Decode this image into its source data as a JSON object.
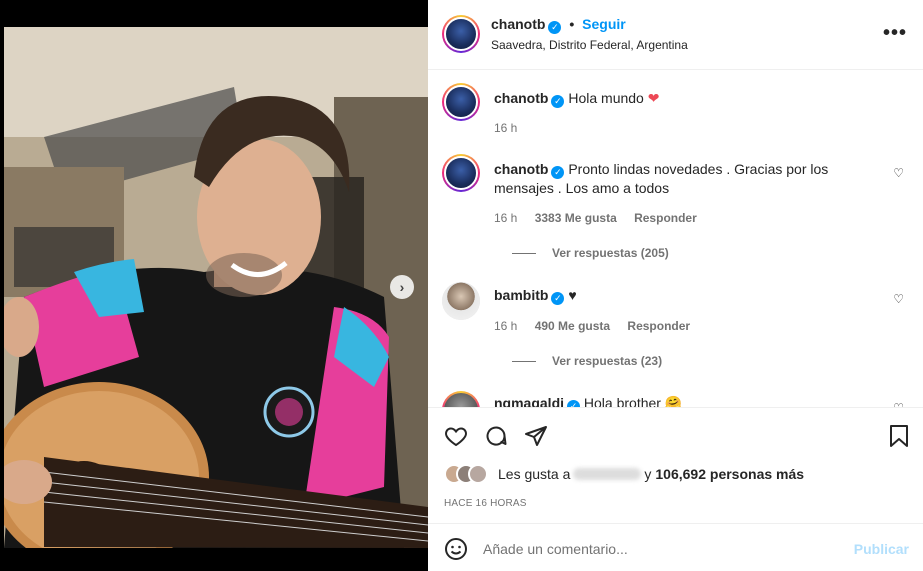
{
  "post": {
    "author": "chanotb",
    "follow_label": "Seguir",
    "dot": "•",
    "location": "Saavedra, Distrito Federal, Argentina",
    "more_label": "•••"
  },
  "comments": [
    {
      "user": "chanotb",
      "text": "Hola mundo",
      "emoji": "❤",
      "time": "16 h",
      "likes": "",
      "reply": ""
    },
    {
      "user": "chanotb",
      "text": "Pronto lindas novedades . Gracias por los mensajes . Los amo a todos",
      "time": "16 h",
      "likes": "3383 Me gusta",
      "reply": "Responder",
      "view_replies": "Ver respuestas (205)"
    },
    {
      "user": "bambitb",
      "text": "♥",
      "time": "16 h",
      "likes": "490 Me gusta",
      "reply": "Responder",
      "view_replies": "Ver respuestas (23)"
    },
    {
      "user": "ngmagaldi",
      "text": "Hola brother 🤗"
    }
  ],
  "likes": {
    "prefix": "Les gusta a",
    "suffix": "y",
    "count": "106,692 personas más"
  },
  "timestamp": "HACE 16 HORAS",
  "add_comment": {
    "placeholder": "Añade un comentario...",
    "publish_label": "Publicar"
  },
  "colors": {
    "accent": "#0095f6",
    "heart": "#ed4956",
    "muted": "#737373"
  }
}
